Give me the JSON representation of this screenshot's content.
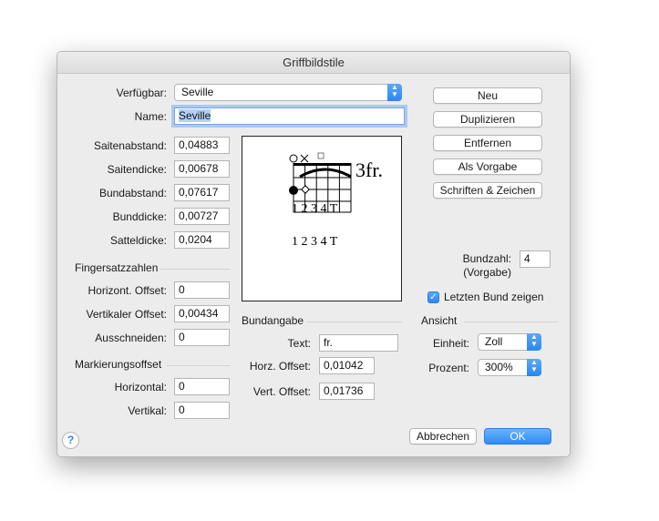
{
  "window": {
    "title": "Griffbildstile"
  },
  "available": {
    "label": "Verfügbar:",
    "value": "Seville"
  },
  "name": {
    "label": "Name:",
    "value": "Seville"
  },
  "metrics": [
    {
      "label": "Saitenabstand:",
      "value": "0,04883"
    },
    {
      "label": "Saitendicke:",
      "value": "0,00678"
    },
    {
      "label": "Bundabstand:",
      "value": "0,07617"
    },
    {
      "label": "Bunddicke:",
      "value": "0,00727"
    },
    {
      "label": "Satteldicke:",
      "value": "0,0204"
    }
  ],
  "fingering": {
    "title": "Fingersatzzahlen",
    "horiz_label": "Horizont. Offset:",
    "horiz_value": "0",
    "vert_label": "Vertikaler Offset:",
    "vert_value": "0,00434",
    "cut_label": "Ausschneiden:",
    "cut_value": "0"
  },
  "marker": {
    "title": "Markierungsoffset",
    "horiz_label": "Horizontal:",
    "horiz_value": "0",
    "vert_label": "Vertikal:",
    "vert_value": "0"
  },
  "preview": {
    "fret_label": "3fr.",
    "fingers_row1": "1 2 3 4 T",
    "fingers_row2": "1 2 3 4 T"
  },
  "buttons": {
    "new": "Neu",
    "duplicate": "Duplizieren",
    "remove": "Entfernen",
    "default": "Als Vorgabe",
    "fonts": "Schriften & Zeichen",
    "cancel": "Abbrechen",
    "ok": "OK",
    "help": "?"
  },
  "fret_count": {
    "label_line1": "Bundzahl:",
    "label_line2": "(Vorgabe)",
    "value": "4"
  },
  "show_last_fret": {
    "label": "Letzten Bund zeigen",
    "checked": true
  },
  "fret_info": {
    "title": "Bundangabe",
    "text_label": "Text:",
    "text_value": "fr.",
    "horz_label": "Horz. Offset:",
    "horz_value": "0,01042",
    "vert_label": "Vert. Offset:",
    "vert_value": "0,01736"
  },
  "view": {
    "title": "Ansicht",
    "unit_label": "Einheit:",
    "unit_value": "Zoll",
    "percent_label": "Prozent:",
    "percent_value": "300%"
  },
  "colors": {
    "accent": "#2b86f2",
    "dialog_bg": "#ececec"
  }
}
